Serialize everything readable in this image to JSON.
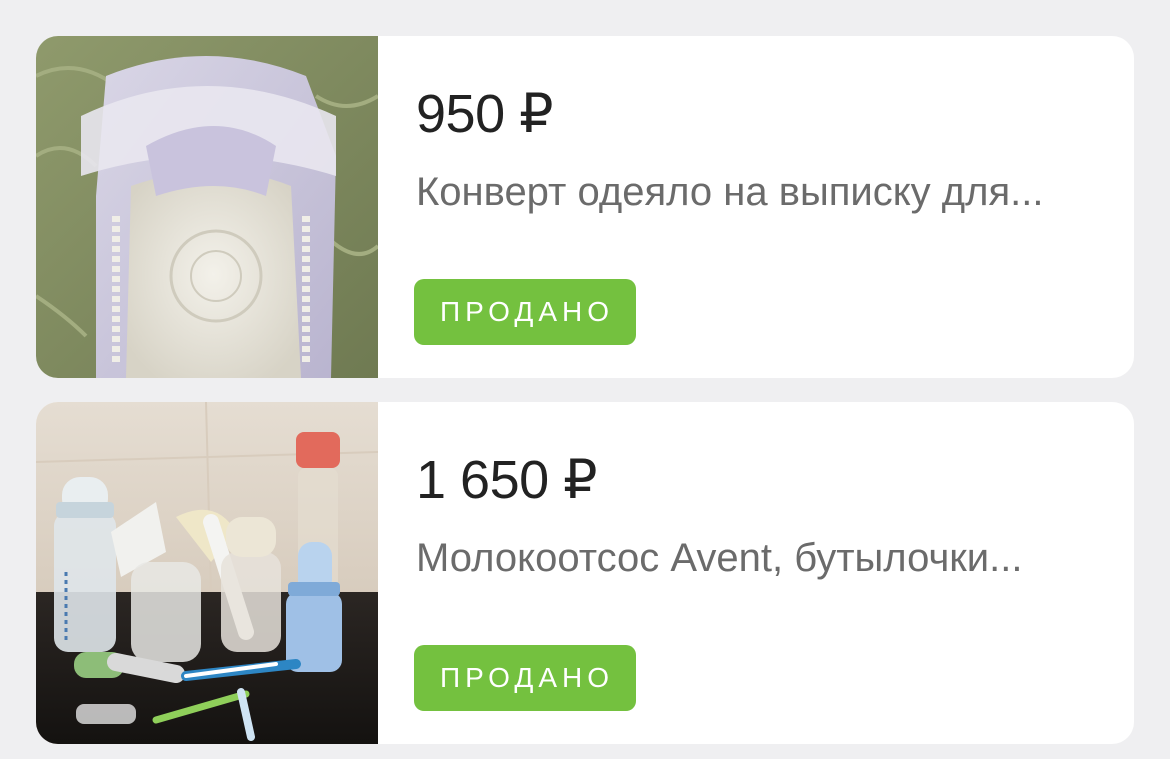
{
  "listings": [
    {
      "price": "950 ₽",
      "title": "Конверт одеяло на выписку для...",
      "status": "ПРОДАНО",
      "photo_icon": "baby-envelope-blanket-photo"
    },
    {
      "price": "1 650 ₽",
      "title": "Молокоотсос Avent, бутылочки...",
      "status": "ПРОДАНО",
      "photo_icon": "breast-pump-bottles-photo"
    }
  ],
  "colors": {
    "background": "#efeff1",
    "card": "#ffffff",
    "badge": "#74c13f",
    "price_text": "#222222",
    "title_text": "#6b6b6b"
  }
}
